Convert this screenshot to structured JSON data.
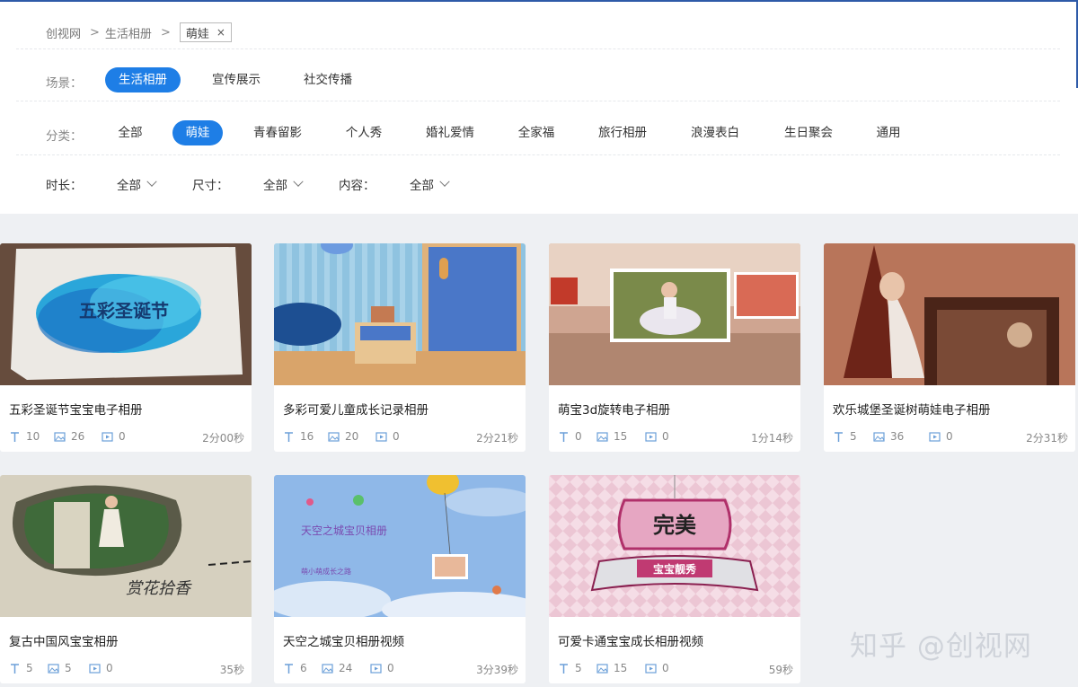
{
  "breadcrumb": {
    "home": "创视网",
    "category": "生活相册",
    "tag": "萌娃",
    "separator": ">",
    "close_glyph": "×"
  },
  "filters": {
    "scene_label": "场景：",
    "scenes": [
      "生活相册",
      "宣传展示",
      "社交传播"
    ],
    "active_scene": "生活相册",
    "category_label": "分类：",
    "categories": [
      "全部",
      "萌娃",
      "青春留影",
      "个人秀",
      "婚礼爱情",
      "全家福",
      "旅行相册",
      "浪漫表白",
      "生日聚会",
      "通用"
    ],
    "active_category": "萌娃",
    "duration_label": "时长：",
    "duration_value": "全部",
    "size_label": "尺寸：",
    "size_value": "全部",
    "content_label": "内容：",
    "content_value": "全部"
  },
  "accent_color": "#1e7ee6",
  "cards": [
    {
      "title": "五彩圣诞节宝宝电子相册",
      "text_count": "10",
      "image_count": "26",
      "video_count": "0",
      "duration": "2分00秒",
      "thumb_text": "五彩圣诞节"
    },
    {
      "title": "多彩可爱儿童成长记录相册",
      "text_count": "16",
      "image_count": "20",
      "video_count": "0",
      "duration": "2分21秒"
    },
    {
      "title": "萌宝3d旋转电子相册",
      "text_count": "0",
      "image_count": "15",
      "video_count": "0",
      "duration": "1分14秒"
    },
    {
      "title": "欢乐城堡圣诞树萌娃电子相册",
      "text_count": "5",
      "image_count": "36",
      "video_count": "0",
      "duration": "2分31秒"
    },
    {
      "title": "复古中国风宝宝相册",
      "text_count": "5",
      "image_count": "5",
      "video_count": "0",
      "duration": "35秒",
      "thumb_text": "赏花拾香"
    },
    {
      "title": "天空之城宝贝相册视频",
      "text_count": "6",
      "image_count": "24",
      "video_count": "0",
      "duration": "3分39秒",
      "thumb_text": "天空之城宝贝相册",
      "thumb_subtext": "萌小萌成长之路"
    },
    {
      "title": "可爱卡通宝宝成长相册视频",
      "text_count": "5",
      "image_count": "15",
      "video_count": "0",
      "duration": "59秒",
      "thumb_text": "完美",
      "thumb_subtext": "宝宝靓秀"
    }
  ],
  "watermark": "知乎 @创视网"
}
